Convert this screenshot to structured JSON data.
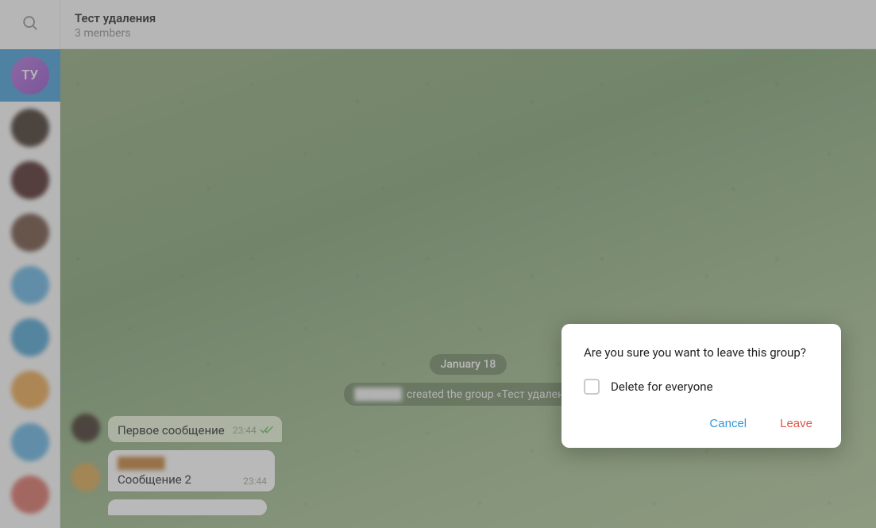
{
  "header": {
    "title": "Тест удаления",
    "subtitle": "3 members"
  },
  "sidebar": {
    "active_chat_initials": "ТУ"
  },
  "chat": {
    "date_label": "January 18",
    "service_message": {
      "actor": "██████",
      "text": "created the group «Тест удаления»"
    },
    "messages": [
      {
        "sender": "██████",
        "sender_color": "#c07a2f",
        "text": "Первое сообщение",
        "time": "23:44",
        "outgoing": true,
        "read": true
      },
      {
        "sender": "██████",
        "sender_color": "#5aa3d6",
        "text": "Сообщение 2",
        "time": "23:44",
        "outgoing": false,
        "read": false
      }
    ]
  },
  "dialog": {
    "message": "Are you sure you want to leave this group?",
    "checkbox_label": "Delete for everyone",
    "checkbox_checked": false,
    "cancel_label": "Cancel",
    "confirm_label": "Leave"
  },
  "colors": {
    "accent": "#2f97db",
    "danger": "#e05448",
    "active_chat_bg": "#3e99d6"
  }
}
